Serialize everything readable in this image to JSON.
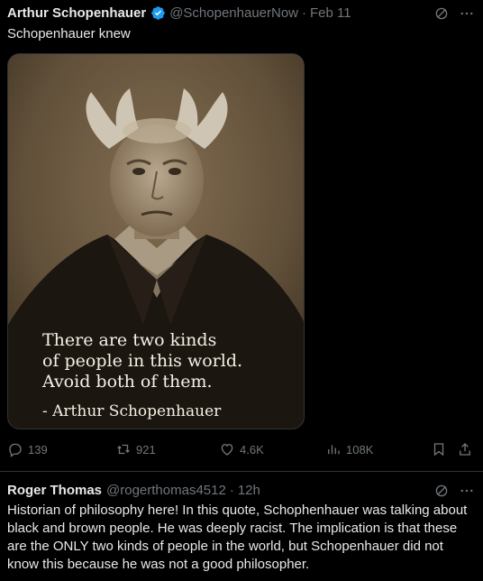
{
  "tweet": {
    "author_name": "Arthur Schopenhauer",
    "handle": "@SchopenhauerNow",
    "separator": "·",
    "date": "Feb 11",
    "text": "Schopenhauer knew",
    "image_quote": "There are two kinds\nof people in this world.\nAvoid both of them.",
    "image_attribution": "- Arthur Schopenhauer",
    "stats": {
      "replies": "139",
      "reposts": "921",
      "likes": "4.6K",
      "views": "108K"
    }
  },
  "reply": {
    "author_name": "Roger Thomas",
    "handle": "@rogerthomas4512",
    "separator": "·",
    "time": "12h",
    "text": "Historian of philosophy here! In this quote, Schophenhauer was talking about black and brown people. He was deeply racist. The implication is that these are the ONLY two kinds of people in the world, but Schopenhauer did not know this because he was not a good philosopher."
  },
  "colors": {
    "background": "#000000",
    "text": "#e7e9ea",
    "muted": "#71767b",
    "verified": "#1d9bf0"
  },
  "icons": [
    "verified-badge-icon",
    "grok-icon",
    "more-icon",
    "reply-icon",
    "repost-icon",
    "like-icon",
    "views-icon",
    "bookmark-icon",
    "share-icon"
  ]
}
